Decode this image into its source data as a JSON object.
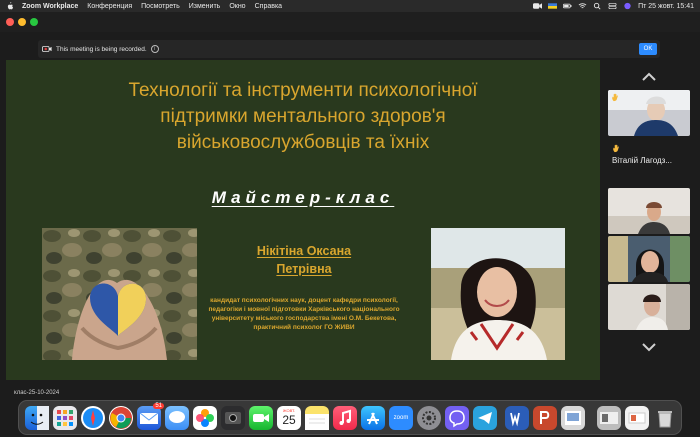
{
  "menubar": {
    "app_name": "Zoom Workplace",
    "items": [
      "Конференция",
      "Посмотреть",
      "Изменить",
      "Окно",
      "Справка"
    ],
    "clock": "Пт 25 жовт.  15:41"
  },
  "recording": {
    "message": "This meeting is being recorded.",
    "ok_label": "OK"
  },
  "slide": {
    "title_lines": [
      "Технології та інструменти психологічної",
      "підтримки ментального здоров'я",
      "військовослужбовців та їхніх"
    ],
    "subtitle": "Майстер-клас",
    "speaker_name_lines": [
      "Нікітіна Оксана",
      "Петрівна"
    ],
    "speaker_bio": "кандидат психологічних наук, доцент кафедри психології, педагогіки і мовної підготовки Харківського національного університету міського господарства імені О.М. Бекетова, практичний психолог ГО ЖИВИ"
  },
  "gallery": {
    "participant_name": "Віталій Лагодз..."
  },
  "bottom_label": "клас-25-10-2024",
  "dock": {
    "calendar_month": "ЖОВТ.",
    "calendar_day": "25",
    "mail_badge": "51",
    "zoom_label": "zoom"
  },
  "colors": {
    "slide_background": "#29391e",
    "title_gold": "#d9a62e",
    "zoom_blue": "#2d8cff",
    "recording_red": "#e04040"
  }
}
